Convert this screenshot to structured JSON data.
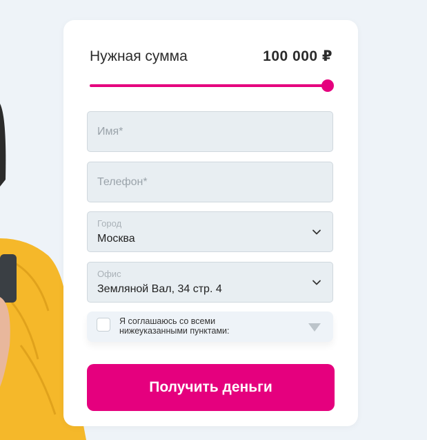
{
  "loan": {
    "amount_label": "Нужная сумма",
    "amount_value": "100 000 ₽",
    "slider_fraction": 1.0
  },
  "form": {
    "name_placeholder": "Имя*",
    "phone_placeholder": "Телефон*",
    "city": {
      "label": "Город",
      "value": "Москва"
    },
    "office": {
      "label": "Офис",
      "value": "Земляной Вал, 34 стр. 4"
    },
    "consent_text": "Я соглашаюсь со всеми нижеуказанными пунктами:",
    "consent_checked": false,
    "submit_label": "Получить деньги"
  },
  "colors": {
    "accent": "#e5007e",
    "page_background": "#eef3f8",
    "field_background": "#e8eef2",
    "sweater": "#f5b82a"
  }
}
